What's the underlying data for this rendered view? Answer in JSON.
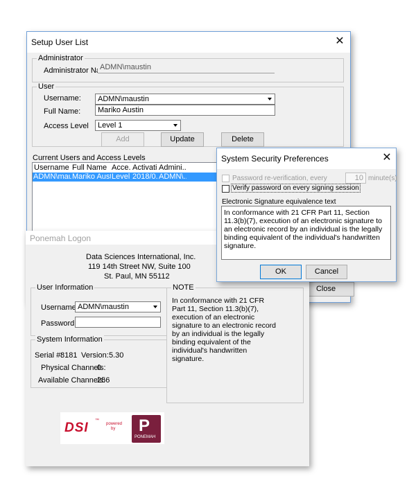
{
  "setup_dialog": {
    "title": "Setup User List",
    "admin_group": "Administrator",
    "admin_name_label": "Administrator Name",
    "admin_name_value": "ADMN\\maustin",
    "user_group": "User",
    "username_label": "Username:",
    "username_value": "ADMN\\maustin",
    "fullname_label": "Full Name:",
    "fullname_value": "Mariko Austin",
    "access_label": "Access Level",
    "access_value": "Level 1",
    "add_label": "Add",
    "update_label": "Update",
    "delete_label": "Delete",
    "list_group": "Current Users and Access Levels",
    "columns": [
      "Username",
      "Full Name",
      "Acce...",
      "Activati...",
      "Admini..."
    ],
    "rows": [
      [
        "ADMN\\maustin",
        "Mariko Austin",
        "Level 1",
        "2018/0...",
        "ADMN\\..."
      ]
    ],
    "close_label": "Close"
  },
  "security_dialog": {
    "title": "System Security Preferences",
    "reverify_label": "Password re-verification, every",
    "reverify_value": "10",
    "reverify_unit": "minute(s)",
    "verify_label": "Verify password on every signing session",
    "esig_label": "Electronic Signature equivalence text",
    "esig_text": "In conformance with 21 CFR Part 11, Section 11.3(b)(7), execution of an electronic signature to an electronic record by an individual is the legally binding equivalent of the individual's handwritten signature.",
    "ok_label": "OK",
    "cancel_label": "Cancel"
  },
  "logon_dialog": {
    "title": "Ponemah Logon",
    "company_line1": "Data Sciences International, Inc.",
    "company_line2": "119 14th Street NW, Suite 100",
    "company_line3": "St. Paul, MN 55112",
    "user_info_group": "User Information",
    "username_label": "Username:",
    "username_value": "ADMN\\maustin",
    "password_label": "Password:",
    "password_value": "",
    "note_group": "NOTE",
    "note_text": "In conformance with 21 CFR Part 11, Section 11.3(b)(7), execution of an electronic signature to an electronic record by an individual is the legally binding equivalent of the individual's handwritten signature.",
    "sys_info_group": "System Information",
    "serial_label": "Serial #:",
    "serial_value": "8181",
    "version_label": "Version:",
    "version_value": "5.30",
    "phys_label": "Physical Channels:",
    "phys_value": "0",
    "avail_label": "Available Channels:",
    "avail_value": "256",
    "logo_dsi": "DSI",
    "logo_tm": "™",
    "logo_powered": "powered",
    "logo_by": "by",
    "logo_ponemah": "PONEMAH",
    "logo_p": "P",
    "brand_red": "#c8102e",
    "brand_maroon": "#7a1f3d"
  }
}
